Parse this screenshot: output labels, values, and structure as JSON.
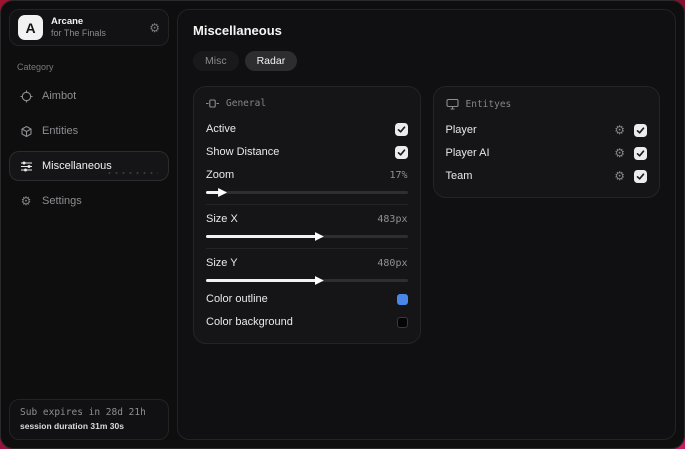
{
  "sidebar": {
    "brand": {
      "initial": "A",
      "title": "Arcane",
      "subtitle": "for The Finals"
    },
    "category_label": "Category",
    "items": [
      {
        "label": "Aimbot"
      },
      {
        "label": "Entities"
      },
      {
        "label": "Miscellaneous"
      },
      {
        "label": "Settings"
      }
    ],
    "subscription": {
      "expiry": "Sub expires in 28d 21h",
      "session": "session duration 31m 30s"
    }
  },
  "main": {
    "title": "Miscellaneous",
    "tabs": [
      {
        "label": "Misc"
      },
      {
        "label": "Radar"
      }
    ],
    "general": {
      "title": "General",
      "active_label": "Active",
      "show_distance_label": "Show Distance",
      "zoom_label": "Zoom",
      "zoom_value": "17%",
      "zoom_fill": 7,
      "size_x_label": "Size X",
      "size_x_value": "483px",
      "size_x_fill": 55,
      "size_y_label": "Size Y",
      "size_y_value": "480px",
      "size_y_fill": 55,
      "color_outline_label": "Color outline",
      "color_background_label": "Color background"
    },
    "entities": {
      "title": "Entityes",
      "rows": [
        {
          "label": "Player",
          "checked": true
        },
        {
          "label": "Player AI",
          "checked": true
        },
        {
          "label": "Team",
          "checked": true
        }
      ]
    }
  },
  "colors": {
    "outline_swatch": "#4a86e8",
    "background_swatch": "#050505"
  }
}
